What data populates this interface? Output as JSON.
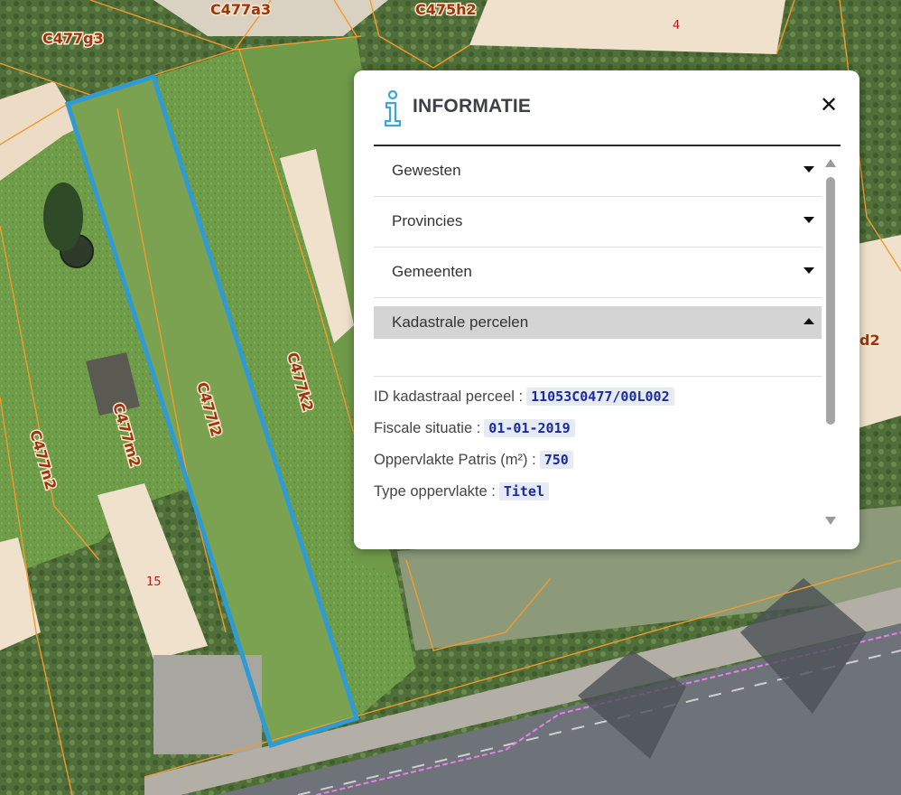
{
  "map": {
    "parcel_labels": [
      "C477a3",
      "C475h2",
      "C477g3",
      "C477l2",
      "C477k2",
      "C477m2",
      "C477n2",
      "d2"
    ],
    "house_numbers": [
      "4",
      "15"
    ],
    "colors": {
      "selection": "#2e9ad6",
      "parcel_border": "#f29b2c",
      "road": "#6d7378",
      "grass": "#6c9a45",
      "roof": "#efe1cb"
    }
  },
  "panel": {
    "title": "INFORMATIE",
    "close_label": "✕",
    "icon": "info-icon",
    "accordion": [
      {
        "label": "Gewesten",
        "state": "collapsed"
      },
      {
        "label": "Provincies",
        "state": "collapsed"
      },
      {
        "label": "Gemeenten",
        "state": "collapsed"
      },
      {
        "label": "Kadastrale percelen",
        "state": "expanded"
      }
    ],
    "properties": [
      {
        "label": "ID kadastraal perceel :",
        "value": "11053C0477/00L002"
      },
      {
        "label": "Fiscale situatie :",
        "value": "01-01-2019"
      },
      {
        "label": "Oppervlakte Patris (m²) :",
        "value": "750"
      },
      {
        "label": "Type oppervlakte :",
        "value": "Titel"
      }
    ]
  }
}
